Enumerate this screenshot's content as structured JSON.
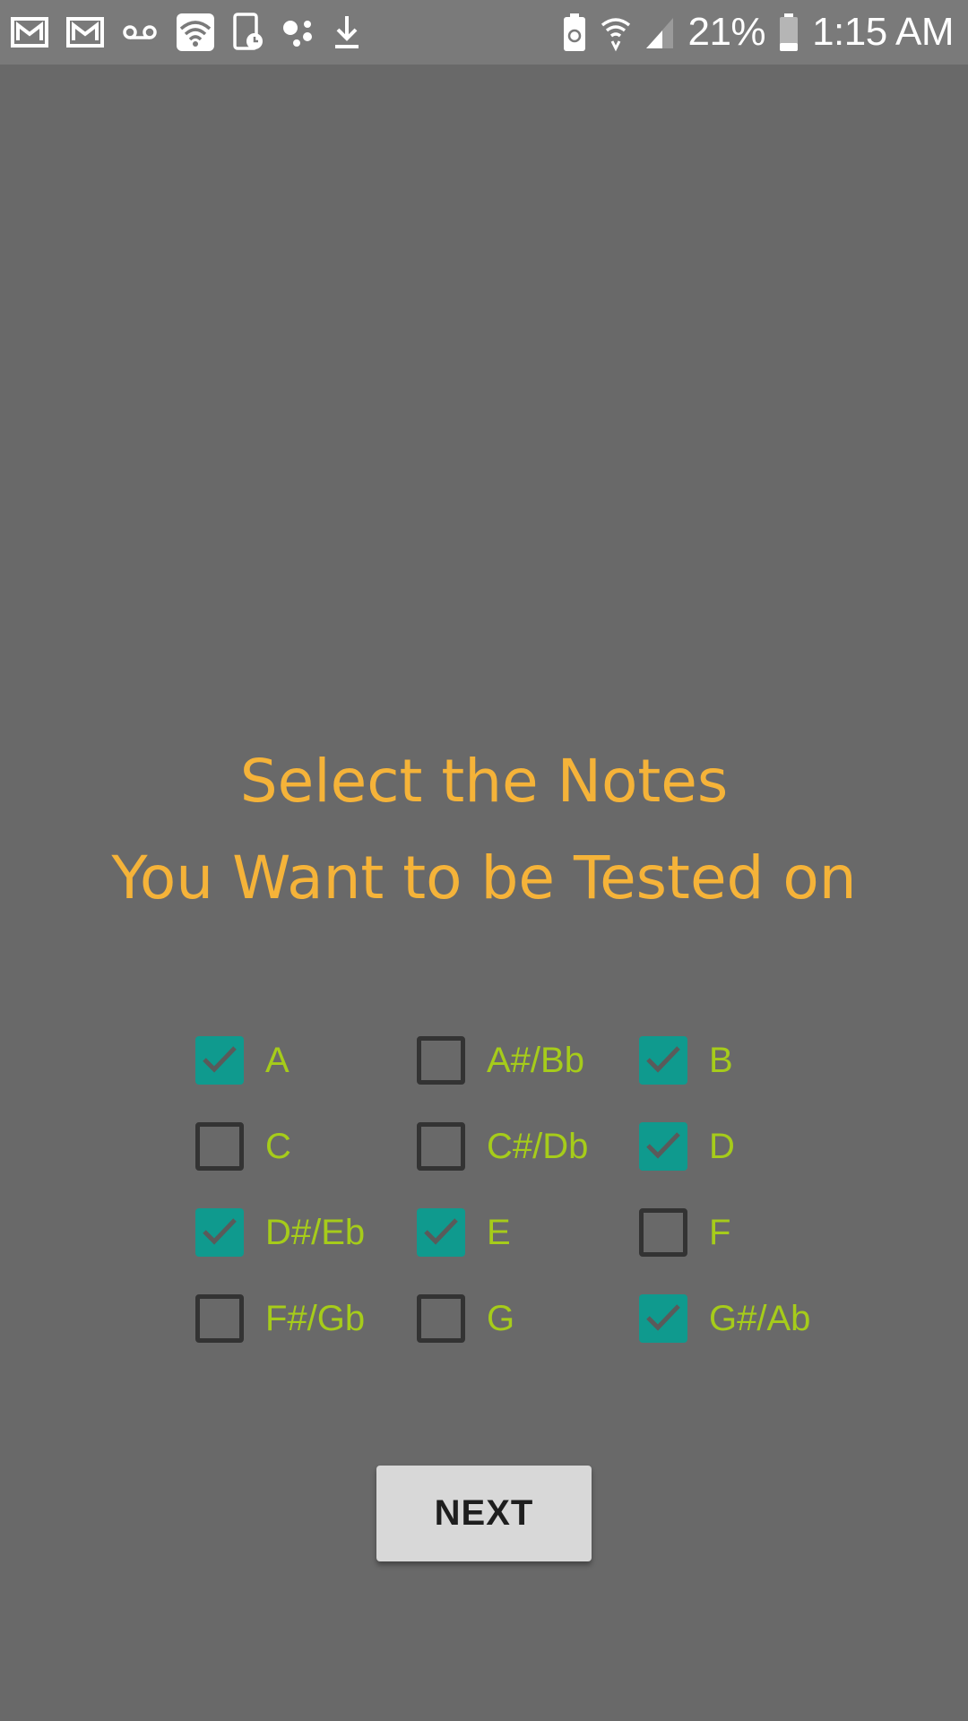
{
  "status_bar": {
    "left_icons": [
      "gmail-icon",
      "gmail-icon",
      "voicemail-icon",
      "wifi-icon",
      "screen-timer-icon",
      "assistant-icon",
      "download-icon"
    ],
    "battery_percent": "21%",
    "time": "1:15 AM"
  },
  "title": {
    "line1": "Select the Notes",
    "line2": "You Want to be Tested on"
  },
  "notes": [
    {
      "label": "A",
      "checked": true
    },
    {
      "label": "A#/Bb",
      "checked": false
    },
    {
      "label": "B",
      "checked": true
    },
    {
      "label": "C",
      "checked": false
    },
    {
      "label": "C#/Db",
      "checked": false
    },
    {
      "label": "D",
      "checked": true
    },
    {
      "label": "D#/Eb",
      "checked": true
    },
    {
      "label": "E",
      "checked": true
    },
    {
      "label": "F",
      "checked": false
    },
    {
      "label": "F#/Gb",
      "checked": false
    },
    {
      "label": "G",
      "checked": false
    },
    {
      "label": "G#/Ab",
      "checked": true
    }
  ],
  "next_button": {
    "label": "NEXT"
  },
  "colors": {
    "background": "#696969",
    "title": "#f5b339",
    "note_label": "#a6cc1a",
    "checkbox_checked": "#0f9a8e",
    "checkbox_border": "#333333",
    "button": "#d8d8d8"
  }
}
